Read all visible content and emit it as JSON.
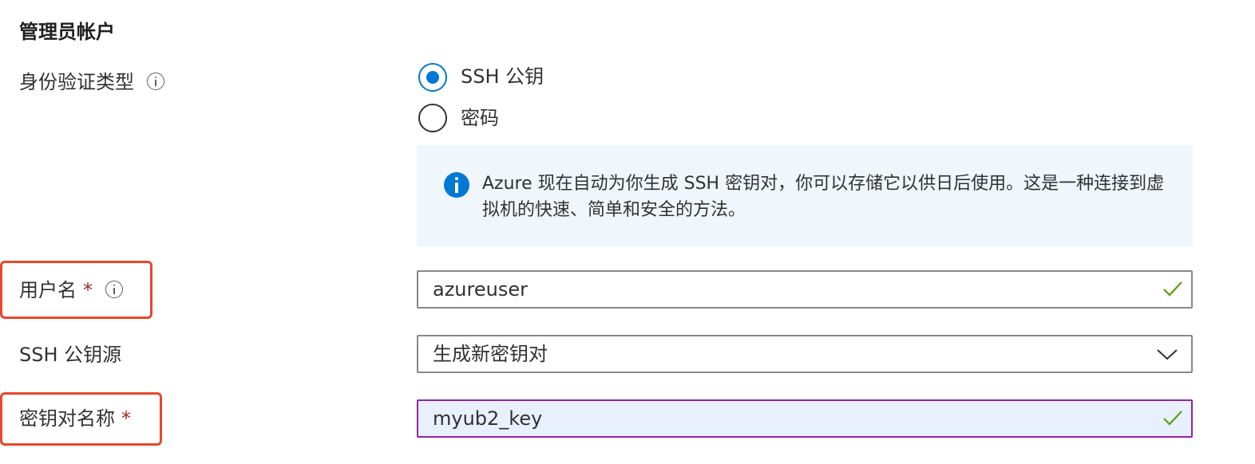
{
  "section": {
    "title": "管理员帐户"
  },
  "auth_type": {
    "label": "身份验证类型",
    "options": [
      {
        "label": "SSH 公钥",
        "selected": true
      },
      {
        "label": "密码",
        "selected": false
      }
    ]
  },
  "info_box": {
    "text": "Azure 现在自动为你生成 SSH 密钥对，你可以存储它以供日后使用。这是一种连接到虚拟机的快速、简单和安全的方法。"
  },
  "username": {
    "label": "用户名",
    "required_mark": "*",
    "value": "azureuser"
  },
  "ssh_source": {
    "label": "SSH 公钥源",
    "selected": "生成新密钥对"
  },
  "key_pair_name": {
    "label": "密钥对名称",
    "required_mark": "*",
    "value": "myub2_key"
  },
  "colors": {
    "accent": "#0078d4",
    "valid": "#57a300",
    "required": "#a4262c",
    "highlight": "#e8472b",
    "focus_border": "#8e24aa"
  }
}
